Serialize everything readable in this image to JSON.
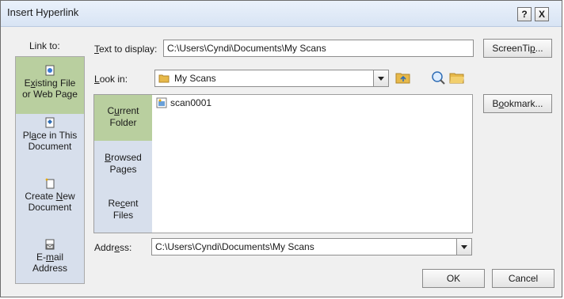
{
  "window": {
    "title": "Insert Hyperlink",
    "help_glyph": "?",
    "close_glyph": "X"
  },
  "link_to": {
    "header": "Link to:",
    "items": [
      {
        "pre": "E",
        "key": "x",
        "post": "isting File",
        "line2": "or Web Page",
        "icon": "web-page-icon",
        "active": true
      },
      {
        "pre": "Pl",
        "key": "a",
        "post": "ce in This",
        "line2": "Document",
        "icon": "place-in-document-icon",
        "active": false
      },
      {
        "pre": "Create ",
        "key": "N",
        "post": "ew",
        "line2": "Document",
        "icon": "new-document-icon",
        "active": false
      },
      {
        "pre": "E-",
        "key": "m",
        "post": "ail",
        "line2": "Address",
        "icon": "email-icon",
        "active": false
      }
    ]
  },
  "text_to_display": {
    "label_key": "T",
    "label_rest": "ext to display:",
    "value": "C:\\Users\\Cyndi\\Documents\\My Scans"
  },
  "screentip_button": {
    "pre": "ScreenTi",
    "key": "p",
    "post": "..."
  },
  "look_in": {
    "label_key": "L",
    "label_rest": "ook in:",
    "value": "My Scans"
  },
  "toolbar_icons": [
    "up-folder-icon",
    "browse-web-icon",
    "browse-file-icon"
  ],
  "bookmark_button": {
    "pre": "B",
    "key": "o",
    "post": "okmark..."
  },
  "browse_tabs": [
    {
      "pre": "C",
      "key": "u",
      "post": "rrent",
      "line2": "Folder",
      "active": true
    },
    {
      "pre": "",
      "key": "B",
      "post": "rowsed",
      "line2": "Pages",
      "active": false
    },
    {
      "pre": "Re",
      "key": "c",
      "post": "ent",
      "line2": "Files",
      "active": false
    }
  ],
  "files": [
    {
      "name": "scan0001",
      "icon": "image-file-icon"
    }
  ],
  "address": {
    "label_pre": "Addr",
    "label_key": "e",
    "label_post": "ss:",
    "value": "C:\\Users\\Cyndi\\Documents\\My Scans"
  },
  "ok_button": "OK",
  "cancel_button": "Cancel"
}
